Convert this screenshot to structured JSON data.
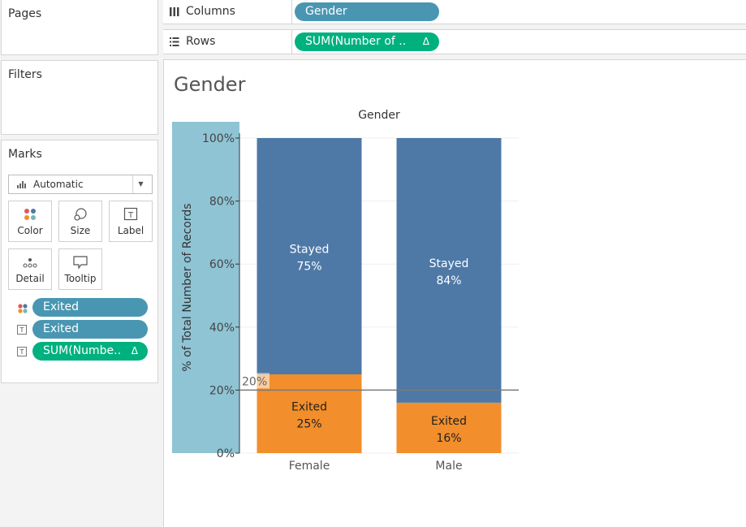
{
  "left_panel": {
    "pages_title": "Pages",
    "filters_title": "Filters",
    "marks": {
      "title": "Marks",
      "mark_type": "Automatic",
      "buttons": [
        {
          "label": "Color",
          "icon": "color-dots-icon"
        },
        {
          "label": "Size",
          "icon": "size-circles-icon"
        },
        {
          "label": "Label",
          "icon": "text-label-icon"
        },
        {
          "label": "Detail",
          "icon": "detail-dots-icon"
        },
        {
          "label": "Tooltip",
          "icon": "tooltip-bubble-icon"
        }
      ],
      "cards": [
        {
          "icon": "color-dots-icon",
          "label": "Exited",
          "type": "dimension"
        },
        {
          "icon": "text-label-icon",
          "label": "Exited",
          "type": "dimension"
        },
        {
          "icon": "text-label-icon",
          "label": "SUM(Numbe..",
          "type": "measure",
          "delta": "Δ"
        }
      ]
    }
  },
  "shelves": {
    "columns": {
      "label": "Columns",
      "icon": "columns-icon",
      "pill": "Gender"
    },
    "rows": {
      "label": "Rows",
      "icon": "rows-icon",
      "pill": "SUM(Number of ..",
      "delta": "Δ"
    }
  },
  "viz": {
    "title": "Gender"
  },
  "colors": {
    "stayed": "#4e79a7",
    "exited": "#f28e2b",
    "axis_band": "#8fc4d5",
    "dimension_pill": "#4996b2",
    "measure_pill": "#00b180"
  },
  "chart_data": {
    "type": "bar",
    "stacked": true,
    "title": "Gender",
    "ylabel": "% of Total Number of Records",
    "xlabel": "",
    "ylim": [
      0,
      100
    ],
    "yticks": [
      "0%",
      "20%",
      "40%",
      "60%",
      "80%",
      "100%"
    ],
    "categories": [
      "Female",
      "Male"
    ],
    "series": [
      {
        "name": "Exited",
        "values": [
          25,
          16
        ],
        "labels": [
          "25%",
          "16%"
        ],
        "color": "#f28e2b"
      },
      {
        "name": "Stayed",
        "values": [
          75,
          84
        ],
        "labels": [
          "75%",
          "84%"
        ],
        "color": "#4e79a7"
      }
    ],
    "reference_line": {
      "value": 20,
      "label": "20%"
    }
  }
}
